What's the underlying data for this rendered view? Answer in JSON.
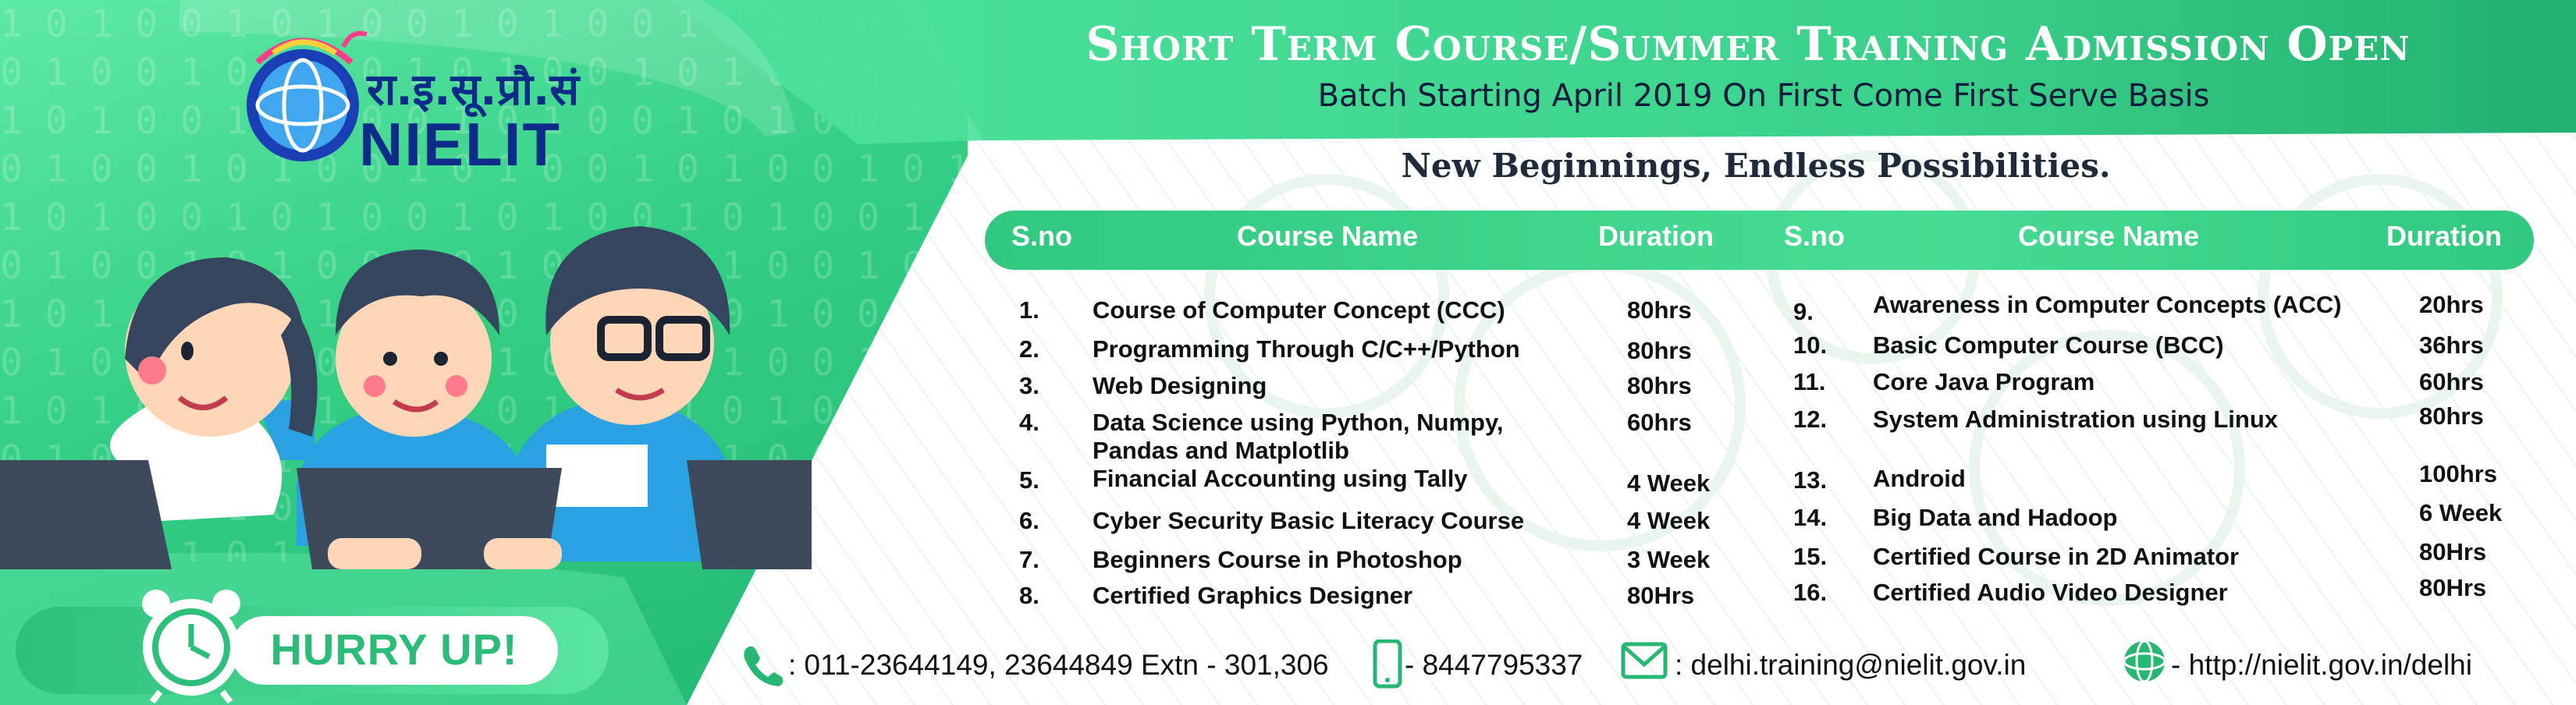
{
  "logo": {
    "hindi": "रा.इ.सू.प्रौ.सं",
    "name": "NIELIT"
  },
  "header": {
    "title": "Short Term Course/Summer Training Admission Open",
    "subtitle": "Batch Starting April 2019 On First Come First Serve Basis",
    "tagline": "New Beginnings, Endless Possibilities."
  },
  "table": {
    "headers": {
      "sno": "S.no",
      "course": "Course Name",
      "duration": "Duration"
    },
    "left": [
      {
        "sno": "1.",
        "name": "Course of Computer Concept (CCC)",
        "duration": "80hrs"
      },
      {
        "sno": "2.",
        "name": "Programming Through C/C++/Python",
        "duration": "80hrs"
      },
      {
        "sno": "3.",
        "name": "Web Designing",
        "duration": "80hrs"
      },
      {
        "sno": "4.",
        "name": "Data Science using Python, Numpy,",
        "name2": "Pandas and Matplotlib",
        "duration": "60hrs"
      },
      {
        "sno": "5.",
        "name": "Financial Accounting using Tally",
        "duration": "4 Week"
      },
      {
        "sno": "6.",
        "name": "Cyber Security Basic Literacy Course",
        "duration": "4 Week"
      },
      {
        "sno": "7.",
        "name": "Beginners Course in Photoshop",
        "duration": "3 Week"
      },
      {
        "sno": "8.",
        "name": "Certified Graphics Designer",
        "duration": "80Hrs"
      }
    ],
    "right": [
      {
        "sno": "9.",
        "name": "Awareness in Computer Concepts (ACC)",
        "duration": "20hrs"
      },
      {
        "sno": "10.",
        "name": "Basic Computer Course (BCC)",
        "duration": "36hrs"
      },
      {
        "sno": "11.",
        "name": "Core Java Program",
        "duration": "60hrs"
      },
      {
        "sno": "12.",
        "name": "System Administration using Linux",
        "duration": "80hrs"
      },
      {
        "sno": "13.",
        "name": "Android",
        "duration": "100hrs"
      },
      {
        "sno": "14.",
        "name": "Big Data and Hadoop",
        "duration": "6 Week"
      },
      {
        "sno": "15.",
        "name": "Certified Course in 2D Animator",
        "duration": "80Hrs"
      },
      {
        "sno": "16.",
        "name": "Certified Audio Video Designer",
        "duration": "80Hrs"
      }
    ]
  },
  "hurry": {
    "label": "HURRY UP!"
  },
  "contact": {
    "phone": ": 011-23644149, 23644849 Extn - 301,306",
    "mobile": "- 8447795337",
    "email": ": delhi.training@nielit.gov.in",
    "website": "- http://nielit.gov.in/delhi"
  },
  "colors": {
    "green": "#33cf85",
    "dark_green": "#22b872",
    "navy": "#0d2c8a"
  },
  "icons": [
    "clock-icon",
    "phone-icon",
    "mobile-icon",
    "email-icon",
    "globe-icon"
  ]
}
